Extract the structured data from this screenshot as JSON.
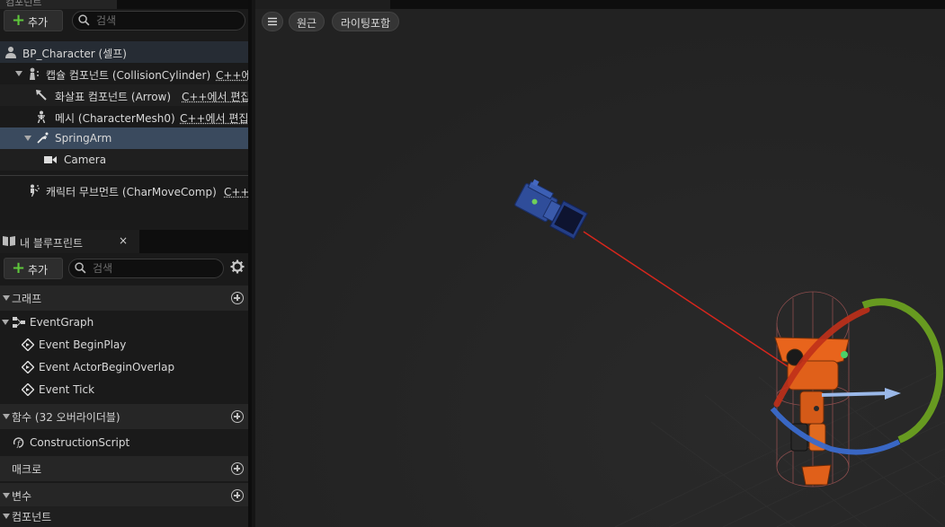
{
  "components_panel": {
    "tab_title": "컴포넌트",
    "add_label": "추가",
    "search_placeholder": "검색",
    "tree": {
      "root": "BP_Character (셀프)",
      "capsule": "캡슐 컴포넌트 (CollisionCylinder)",
      "capsule_cpp": "C++에서 편집",
      "arrow": "화살표 컴포넌트 (Arrow)",
      "arrow_cpp": "C++에서 편집",
      "mesh": "메시 (CharacterMesh0)",
      "mesh_cpp": "C++에서 편집",
      "springarm": "SpringArm",
      "camera": "Camera",
      "movement": "캐릭터 무브먼트 (CharMoveComp)",
      "movement_cpp": "C++에서 편집"
    }
  },
  "my_blueprint": {
    "tab_title": "내 블루프린트",
    "close": "×",
    "add_label": "추가",
    "search_placeholder": "검색",
    "sections": {
      "graphs": "그래프",
      "functions": "함수 (32 오버라이더블)",
      "macros": "매크로",
      "variables": "변수",
      "components": "컴포넌트"
    },
    "event_graph": "EventGraph",
    "events": [
      "Event BeginPlay",
      "Event ActorBeginOverlap",
      "Event Tick"
    ],
    "construction_script": "ConstructionScript"
  },
  "viewport": {
    "menu_icon": "hamburger-icon",
    "perspective_label": "원근",
    "lighting_label": "라이팅포함"
  },
  "colors": {
    "accent_green": "#5ec73b",
    "selection": "#3a4a5e",
    "gizmo_red": "#c0301a",
    "gizmo_green": "#6aa020",
    "gizmo_blue": "#3a6acc"
  }
}
